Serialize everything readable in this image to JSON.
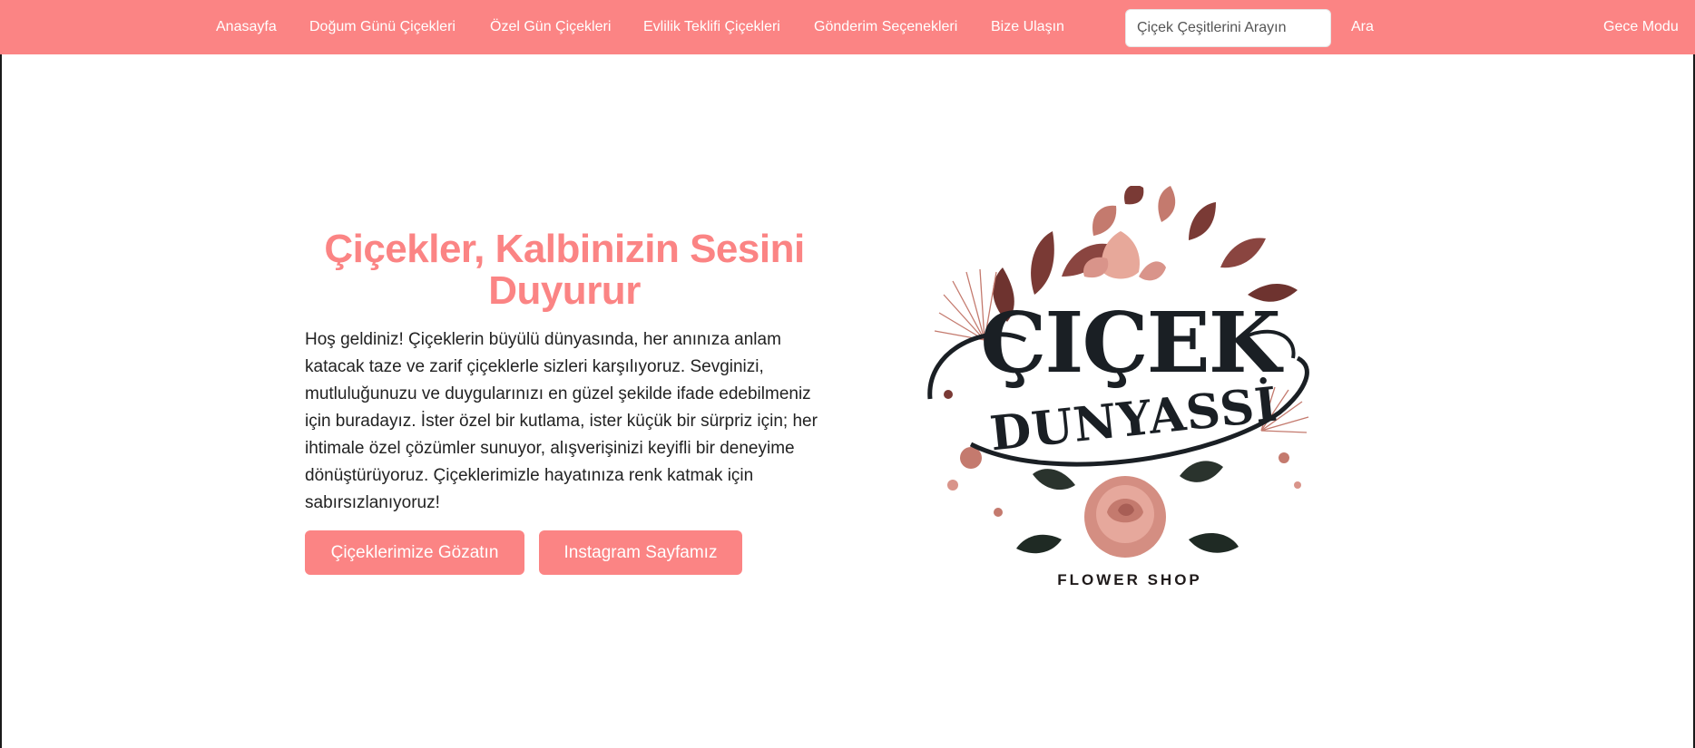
{
  "nav": {
    "items": [
      {
        "label": "Anasayfa"
      },
      {
        "label": "Doğum Günü Çiçekleri"
      },
      {
        "label": "Özel Gün Çiçekleri"
      },
      {
        "label": "Evlilik Teklifi Çiçekleri"
      },
      {
        "label": "Gönderim Seçenekleri"
      },
      {
        "label": "Bize Ulaşın"
      }
    ],
    "search_placeholder": "Çiçek Çeşitlerini Arayın",
    "search_button": "Ara",
    "night_mode": "Gece Modu"
  },
  "hero": {
    "title": "Çiçekler, Kalbinizin Sesini Duyurur",
    "text": "Hoş geldiniz! Çiçeklerin büyülü dünyasında, her anınıza anlam katacak taze ve zarif çiçeklerle sizleri karşılıyoruz. Sevginizi, mutluluğunuzu ve duygularınızı en güzel şekilde ifade edebilmeniz için buradayız. İster özel bir kutlama, ister küçük bir sürpriz için; her ihtimale özel çözümler sunuyor, alışverişinizi keyifli bir deneyime dönüştürüyoruz. Çiçeklerimizle hayatınıza renk katmak için sabırsızlanıyoruz!",
    "primary_button": "Çiçeklerimize Gözatın",
    "secondary_button": "Instagram Sayfamız"
  },
  "logo": {
    "line1": "ÇIÇEK",
    "line2": "DUNYASSİ",
    "caption": "FLOWER SHOP"
  },
  "colors": {
    "accent": "#fb8484",
    "logo_leaf_dark": "#7a3a35",
    "logo_leaf_light": "#c47a6e",
    "logo_ink": "#1a1f24"
  }
}
